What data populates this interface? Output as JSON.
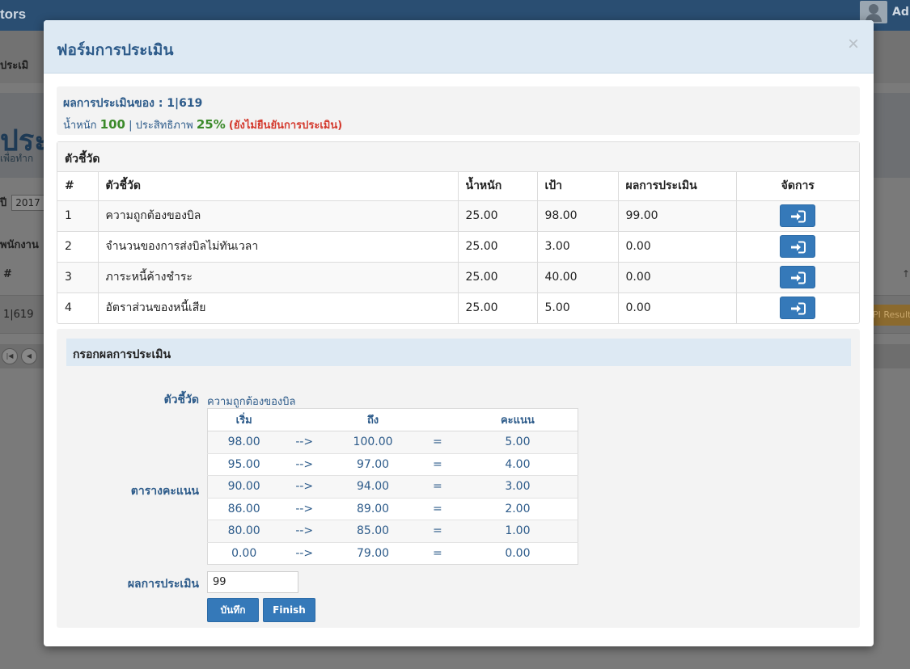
{
  "background": {
    "brand": "tors",
    "user": "Ad",
    "breadcrumb": "ประเมิ",
    "header_title": "ประ",
    "header_sub": "เพื่อทำก",
    "year_label": "ปี",
    "year_value": "2017",
    "employee_label": "พนักงาน",
    "hash": "#",
    "row_id": "1|619",
    "kpi_result_btn": "PI Result"
  },
  "modal": {
    "title": "ฟอร์มการประเมิน",
    "close": "×",
    "summary": {
      "heading": "ผลการประเมินของ : 1|619",
      "weight_label": "น้ำหนัก",
      "weight_value": "100",
      "sep": "|",
      "efficiency_label": "ประสิทธิภาพ",
      "efficiency_value": "25%",
      "status": "(ยังไม่ยืนยันการประเมิน)"
    },
    "kpi_panel_title": "ตัวชี้วัด",
    "kpi_table": {
      "headers": [
        "#",
        "ตัวชี้วัด",
        "น้ำหนัก",
        "เป้า",
        "ผลการประเมิน",
        "จัดการ"
      ],
      "rows": [
        [
          "1",
          "ความถูกต้องของบิล",
          "25.00",
          "98.00",
          "99.00"
        ],
        [
          "2",
          "จำนวนของการส่งบิลไม่ทันเวลา",
          "25.00",
          "3.00",
          "0.00"
        ],
        [
          "3",
          "ภาระหนี้ค้างชำระ",
          "25.00",
          "40.00",
          "0.00"
        ],
        [
          "4",
          "อัตราส่วนของหนี้เสีย",
          "25.00",
          "5.00",
          "0.00"
        ]
      ]
    },
    "entry": {
      "title": "กรอกผลการประเมิน",
      "indicator_label": "ตัวชี้วัด",
      "indicator_value": "ความถูกต้องของบิล",
      "score_table_label": "ตารางคะแนน",
      "score_headers": [
        "เริ่ม",
        "",
        "ถึง",
        "",
        "คะแนน"
      ],
      "score_rows": [
        [
          "98.00",
          "-->",
          "100.00",
          "=",
          "5.00"
        ],
        [
          "95.00",
          "-->",
          "97.00",
          "=",
          "4.00"
        ],
        [
          "90.00",
          "-->",
          "94.00",
          "=",
          "3.00"
        ],
        [
          "86.00",
          "-->",
          "89.00",
          "=",
          "2.00"
        ],
        [
          "80.00",
          "-->",
          "85.00",
          "=",
          "1.00"
        ],
        [
          "0.00",
          "-->",
          "79.00",
          "=",
          "0.00"
        ]
      ],
      "result_label": "ผลการประเมิน",
      "result_value": "99",
      "save_label": "บันทึก",
      "finish_label": "Finish"
    }
  }
}
